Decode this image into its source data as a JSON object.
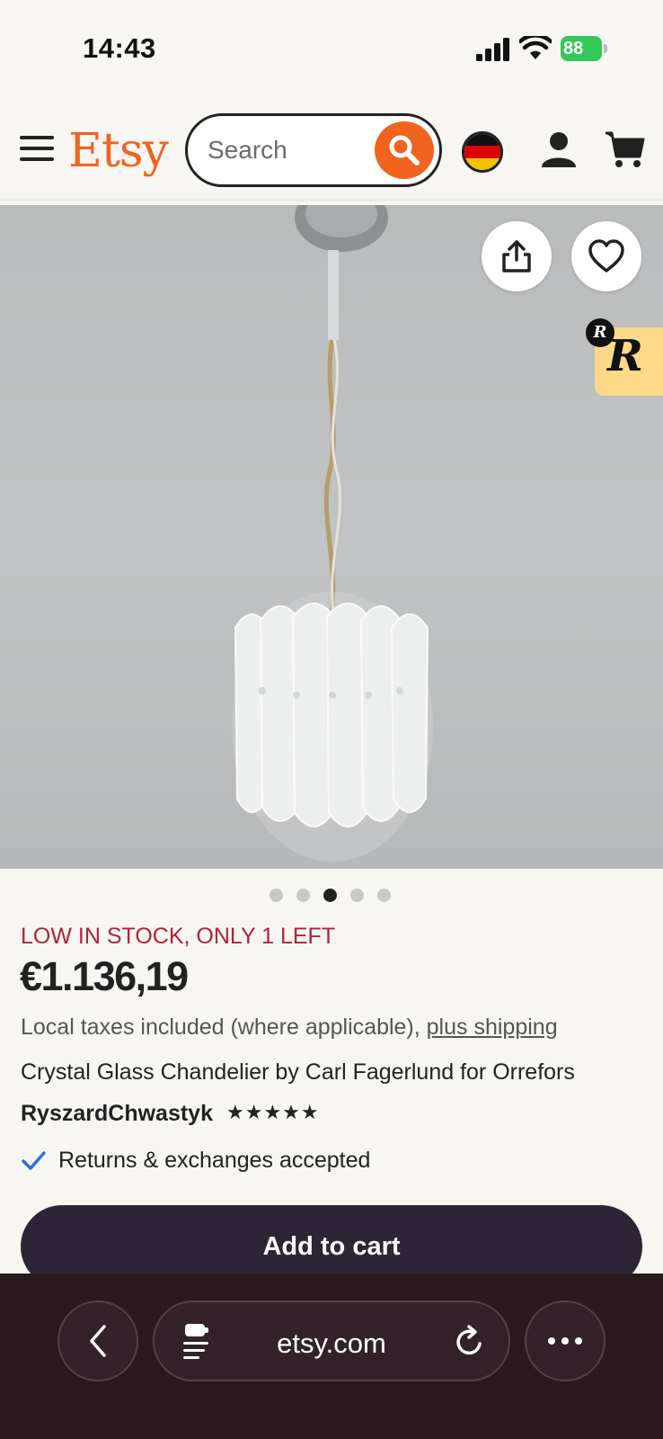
{
  "status": {
    "time": "14:43",
    "battery": "88",
    "icons": [
      "signal-icon",
      "wifi-icon",
      "battery-icon"
    ]
  },
  "header": {
    "logo": "Etsy",
    "search_placeholder": "Search",
    "icons": [
      "menu-icon",
      "search-icon",
      "germany-flag-icon",
      "account-icon",
      "cart-icon"
    ]
  },
  "gallery": {
    "image_count": 5,
    "active_index": 2,
    "badge_letter": "R",
    "badge_small_letter": "R",
    "icons": [
      "share-icon",
      "heart-icon"
    ]
  },
  "listing": {
    "stock_notice": "LOW IN STOCK, ONLY 1 LEFT",
    "price": "€1.136,19",
    "taxes_text": "Local taxes included (where applicable), ",
    "shipping_link": "plus shipping",
    "title": "Crystal Glass Chandelier by Carl Fagerlund for Orrefors",
    "seller": "RyszardChwastyk",
    "rating_stars": "★★★★★",
    "rating_value": 5,
    "returns": "Returns & exchanges accepted",
    "add_to_cart": "Add to cart"
  },
  "browser": {
    "url": "etsy.com",
    "icons": [
      "back-icon",
      "reader-icon",
      "reload-icon",
      "more-icon"
    ]
  },
  "colors": {
    "brand": "#f1641e",
    "stock_alert": "#b0233a",
    "button_dark": "#2d2535",
    "browser_bar": "#2a1a1f",
    "check": "#2f6fd6"
  }
}
